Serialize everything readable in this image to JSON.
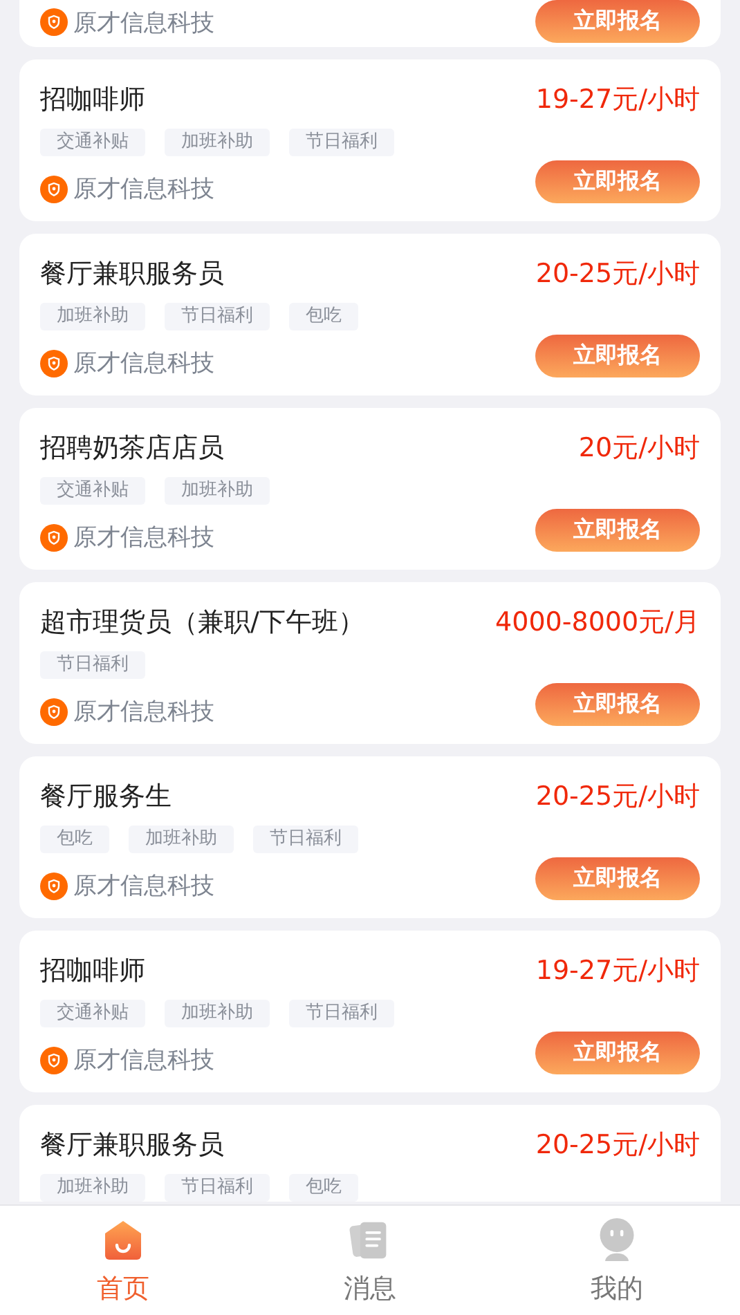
{
  "jobs": [
    {
      "company": "原才信息科技",
      "button": "立即报名"
    },
    {
      "title": "招咖啡师",
      "salary": "19-27元/小时",
      "tags": [
        "交通补贴",
        "加班补助",
        "节日福利"
      ],
      "company": "原才信息科技",
      "button": "立即报名"
    },
    {
      "title": "餐厅兼职服务员",
      "salary": "20-25元/小时",
      "tags": [
        "加班补助",
        "节日福利",
        "包吃"
      ],
      "company": "原才信息科技",
      "button": "立即报名"
    },
    {
      "title": "招聘奶茶店店员",
      "salary": "20元/小时",
      "tags": [
        "交通补贴",
        "加班补助"
      ],
      "company": "原才信息科技",
      "button": "立即报名"
    },
    {
      "title": "超市理货员（兼职/下午班）",
      "salary": "4000-8000元/月",
      "tags": [
        "节日福利"
      ],
      "company": "原才信息科技",
      "button": "立即报名"
    },
    {
      "title": "餐厅服务生",
      "salary": "20-25元/小时",
      "tags": [
        "包吃",
        "加班补助",
        "节日福利"
      ],
      "company": "原才信息科技",
      "button": "立即报名"
    },
    {
      "title": "招咖啡师",
      "salary": "19-27元/小时",
      "tags": [
        "交通补贴",
        "加班补助",
        "节日福利"
      ],
      "company": "原才信息科技",
      "button": "立即报名"
    },
    {
      "title": "餐厅兼职服务员",
      "salary": "20-25元/小时",
      "tags": [
        "加班补助",
        "节日福利",
        "包吃"
      ]
    }
  ],
  "tabbar": [
    {
      "kind": "home",
      "label": "首页",
      "selected": true
    },
    {
      "kind": "messages",
      "label": "消息",
      "selected": false
    },
    {
      "kind": "profile",
      "label": "我的",
      "selected": false
    }
  ]
}
